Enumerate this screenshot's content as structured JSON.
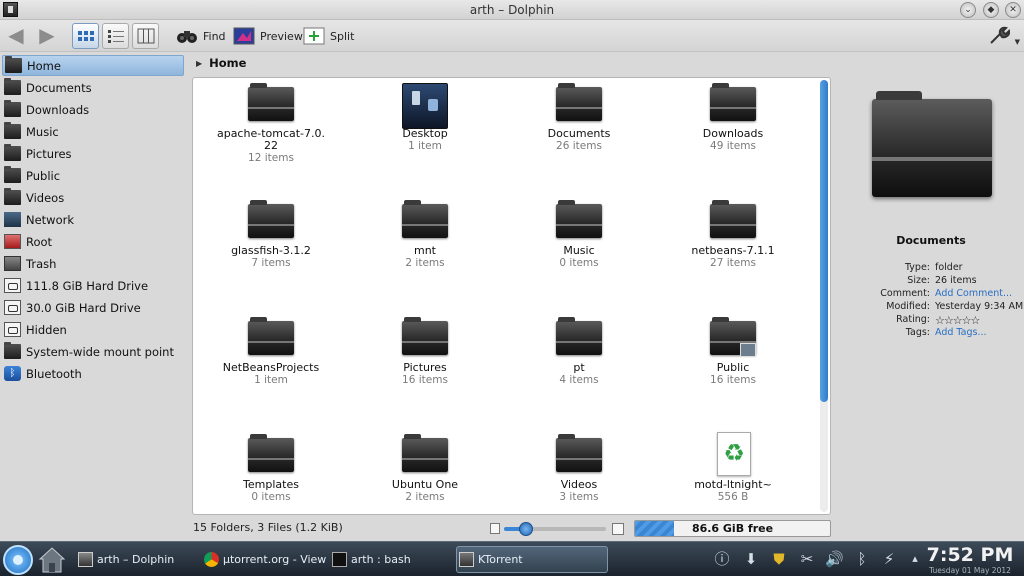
{
  "window": {
    "title": "arth – Dolphin"
  },
  "toolbar": {
    "find_label": "Find",
    "preview_label": "Preview",
    "split_label": "Split"
  },
  "sidebar": {
    "items": [
      {
        "label": "Home",
        "icon": "home-icon"
      },
      {
        "label": "Documents",
        "icon": "folder-icon"
      },
      {
        "label": "Downloads",
        "icon": "folder-icon"
      },
      {
        "label": "Music",
        "icon": "folder-icon"
      },
      {
        "label": "Pictures",
        "icon": "folder-icon"
      },
      {
        "label": "Public",
        "icon": "folder-icon"
      },
      {
        "label": "Videos",
        "icon": "folder-icon"
      },
      {
        "label": "Network",
        "icon": "network-icon"
      },
      {
        "label": "Root",
        "icon": "root-icon"
      },
      {
        "label": "Trash",
        "icon": "trash-icon"
      },
      {
        "label": "111.8 GiB Hard Drive",
        "icon": "hard-drive-icon"
      },
      {
        "label": "30.0 GiB Hard Drive",
        "icon": "hard-drive-icon"
      },
      {
        "label": "Hidden",
        "icon": "hidden-icon"
      },
      {
        "label": "System-wide mount point",
        "icon": "folder-icon"
      },
      {
        "label": "Bluetooth",
        "icon": "bluetooth-icon"
      }
    ]
  },
  "breadcrumb": {
    "current": "Home"
  },
  "files": [
    {
      "name": "apache-tomcat-7.0.\n22",
      "count": "12 items",
      "icon": "folder-icon"
    },
    {
      "name": "Desktop",
      "count": "1 item",
      "icon": "desktop-folder-icon"
    },
    {
      "name": "Documents",
      "count": "26 items",
      "icon": "folder-icon"
    },
    {
      "name": "Downloads",
      "count": "49 items",
      "icon": "folder-icon"
    },
    {
      "name": "glassfish-3.1.2",
      "count": "7 items",
      "icon": "folder-icon"
    },
    {
      "name": "mnt",
      "count": "2 items",
      "icon": "folder-icon"
    },
    {
      "name": "Music",
      "count": "0 items",
      "icon": "folder-icon"
    },
    {
      "name": "netbeans-7.1.1",
      "count": "27 items",
      "icon": "folder-icon"
    },
    {
      "name": "NetBeansProjects",
      "count": "1 item",
      "icon": "folder-icon"
    },
    {
      "name": "Pictures",
      "count": "16 items",
      "icon": "folder-icon"
    },
    {
      "name": "pt",
      "count": "4 items",
      "icon": "folder-icon"
    },
    {
      "name": "Public",
      "count": "16 items",
      "icon": "public-folder-icon"
    },
    {
      "name": "Templates",
      "count": "0 items",
      "icon": "folder-icon"
    },
    {
      "name": "Ubuntu One",
      "count": "2 items",
      "icon": "folder-icon"
    },
    {
      "name": "Videos",
      "count": "3 items",
      "icon": "folder-icon"
    },
    {
      "name": "motd-ltnight~",
      "count": "556 B",
      "icon": "recycle-file-icon"
    }
  ],
  "info_panel": {
    "name": "Documents",
    "rows": [
      {
        "key": "Type:",
        "value": "folder",
        "link": false
      },
      {
        "key": "Size:",
        "value": "26 items",
        "link": false
      },
      {
        "key": "Comment:",
        "value": "Add Comment...",
        "link": true
      },
      {
        "key": "Modified:",
        "value": "Yesterday 9:34 AM",
        "link": false
      },
      {
        "key": "Rating:",
        "value": "☆☆☆☆☆",
        "link": false
      },
      {
        "key": "Tags:",
        "value": "Add Tags...",
        "link": true
      }
    ]
  },
  "statusbar": {
    "summary": "15 Folders, 3 Files (1.2 KiB)",
    "free_space": "86.6 GiB free",
    "disk_used_fraction": 0.2,
    "zoom_fraction": 0.22
  },
  "taskbar": {
    "tasks": [
      {
        "label": "arth – Dolphin",
        "icon": "dolphin-icon"
      },
      {
        "label": "µtorrent.org - View t",
        "icon": "chrome-icon"
      },
      {
        "label": "arth : bash",
        "icon": "terminal-icon"
      },
      {
        "label": "KTorrent",
        "icon": "ktorrent-icon"
      }
    ],
    "clock_time": "7:52 PM",
    "clock_date": "Tuesday 01 May 2012"
  },
  "colors": {
    "accent": "#3b87d6",
    "selection": "#9fc2e6",
    "link": "#2a6fc4"
  }
}
